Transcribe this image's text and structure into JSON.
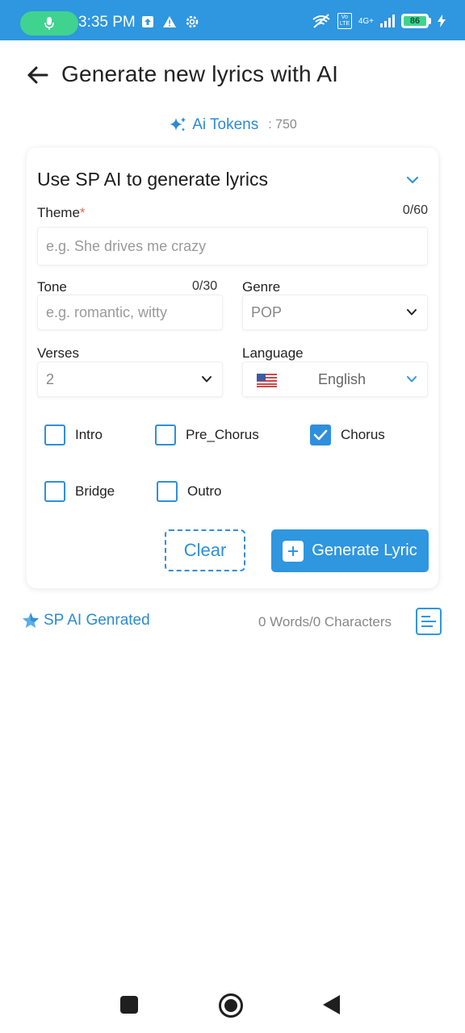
{
  "status_bar": {
    "time": "3:35 PM",
    "battery": "86",
    "network": "4G+",
    "volte": "Vo LTE",
    "icons": [
      "mic-icon",
      "upload-icon",
      "warning-icon",
      "settings-icon",
      "wifi-off-icon",
      "signal-icon",
      "battery-icon",
      "charging-icon"
    ]
  },
  "header": {
    "title": "Generate new lyrics with AI"
  },
  "tokens": {
    "label": "Ai Tokens",
    "value": ": 750"
  },
  "form": {
    "title": "Use SP AI to generate lyrics",
    "theme": {
      "label": "Theme",
      "required_mark": "*",
      "counter": "0/60",
      "placeholder": "e.g. She drives me crazy"
    },
    "tone": {
      "label": "Tone",
      "counter": "0/30",
      "placeholder": "e.g. romantic, witty"
    },
    "genre": {
      "label": "Genre",
      "value": "POP"
    },
    "verses": {
      "label": "Verses",
      "value": "2"
    },
    "language": {
      "label": "Language",
      "value": "English"
    },
    "sections": [
      {
        "label": "Intro",
        "checked": false
      },
      {
        "label": "Pre_Chorus",
        "checked": false
      },
      {
        "label": "Chorus",
        "checked": true
      },
      {
        "label": "Bridge",
        "checked": false
      },
      {
        "label": "Outro",
        "checked": false
      }
    ],
    "clear_label": "Clear",
    "generate_label": "Generate Lyric"
  },
  "result": {
    "label": "SP AI Genrated",
    "count": "0 Words/0 Characters"
  },
  "colors": {
    "accent": "#2f96e0",
    "status_bar": "#2f96e0",
    "mic_pill": "#3fd38f",
    "required": "#e06a4b"
  }
}
